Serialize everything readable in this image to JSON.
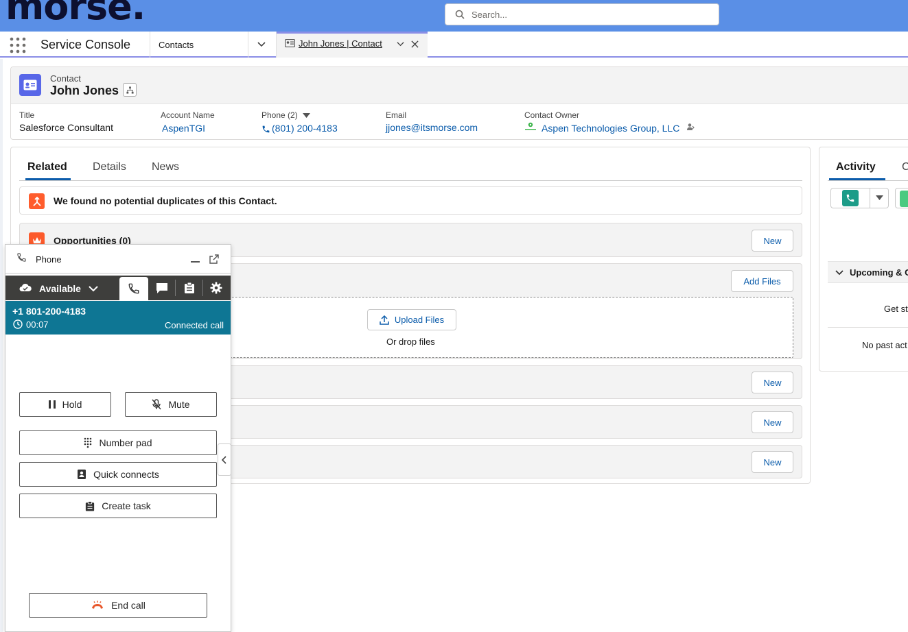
{
  "brand": {
    "logo_text": "morse."
  },
  "search": {
    "placeholder": "Search..."
  },
  "nav": {
    "app_name": "Service Console",
    "object_tab": "Contacts",
    "record_tab": "John Jones | Contact"
  },
  "record": {
    "object_label": "Contact",
    "name": "John Jones",
    "fields": {
      "title_label": "Title",
      "title_value": "Salesforce Consultant",
      "account_label": "Account Name",
      "account_value": "AspenTGI",
      "phone_label": "Phone (2)",
      "phone_value": "(801) 200-4183",
      "email_label": "Email",
      "email_value": "jjones@itsmorse.com",
      "owner_label": "Contact Owner",
      "owner_value": "Aspen Technologies Group, LLC"
    }
  },
  "main_tabs": {
    "related": "Related",
    "details": "Details",
    "news": "News"
  },
  "related": {
    "duplicates_msg": "We found no potential duplicates of this Contact.",
    "opportunities": "Opportunities (0)",
    "new_label": "New",
    "add_files_label": "Add Files",
    "upload_files_label": "Upload Files",
    "drop_files_label": "Or drop files"
  },
  "activity": {
    "tab_label": "Activity",
    "tab2_partial": "C",
    "upcoming_label": "Upcoming & C",
    "get_started_partial": "Get st",
    "no_past_partial": "No past act"
  },
  "phone_panel": {
    "title": "Phone",
    "status": "Available",
    "number": "+1 801-200-4183",
    "timer": "00:07",
    "call_state": "Connected call",
    "hold_label": "Hold",
    "mute_label": "Mute",
    "number_pad_label": "Number pad",
    "quick_connects_label": "Quick connects",
    "create_task_label": "Create task",
    "end_call_label": "End call"
  },
  "colors": {
    "topbar": "#5a8fe6",
    "link": "#0b5cab",
    "call_banner": "#0e7694",
    "phone_toolbar": "#3e3e3c",
    "end_call_icon": "#e8562a",
    "record_icon": "#5867e8",
    "alert_icon": "#ff5d2d"
  }
}
